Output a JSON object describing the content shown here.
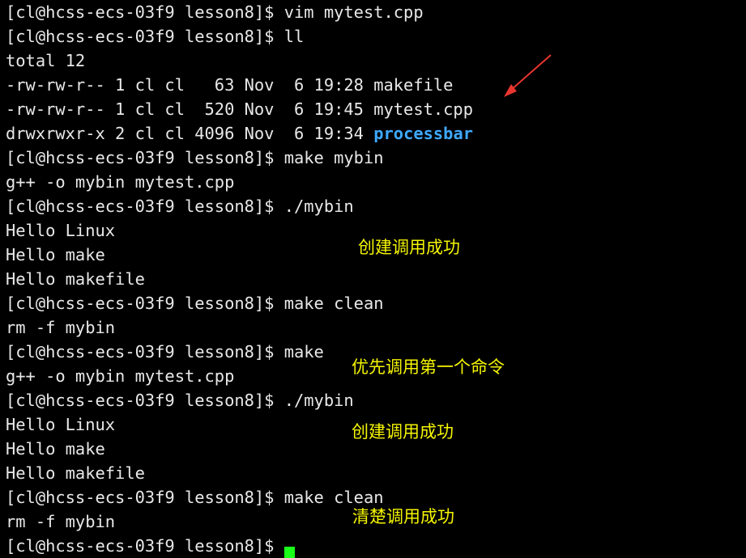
{
  "terminal": {
    "lines": [
      "[cl@hcss-ecs-03f9 lesson8]$ vim mytest.cpp",
      "[cl@hcss-ecs-03f9 lesson8]$ ll",
      "total 12",
      "-rw-rw-r-- 1 cl cl   63 Nov  6 19:28 makefile",
      "-rw-rw-r-- 1 cl cl  520 Nov  6 19:45 mytest.cpp",
      "",
      "[cl@hcss-ecs-03f9 lesson8]$ make mybin",
      "g++ -o mybin mytest.cpp",
      "[cl@hcss-ecs-03f9 lesson8]$ ./mybin",
      "Hello Linux",
      "Hello make",
      "Hello makefile",
      "[cl@hcss-ecs-03f9 lesson8]$ make clean",
      "rm -f mybin",
      "[cl@hcss-ecs-03f9 lesson8]$ make",
      "g++ -o mybin mytest.cpp",
      "[cl@hcss-ecs-03f9 lesson8]$ ./mybin",
      "Hello Linux",
      "Hello make",
      "Hello makefile",
      "[cl@hcss-ecs-03f9 lesson8]$ make clean",
      "rm -f mybin",
      "[cl@hcss-ecs-03f9 lesson8]$ "
    ],
    "dir_line_prefix": "drwxrwxr-x 2 cl cl 4096 Nov  6 19:34 ",
    "dir_name": "processbar"
  },
  "annotations": {
    "note1": "创建调用成功",
    "note2": "优先调用第一个命令",
    "note3": "创建调用成功",
    "note4": "清楚调用成功"
  },
  "colors": {
    "note": "#f5f500",
    "directory": "#3ea9ff",
    "cursor": "#1aff1a",
    "arrow": "#e8352f"
  }
}
